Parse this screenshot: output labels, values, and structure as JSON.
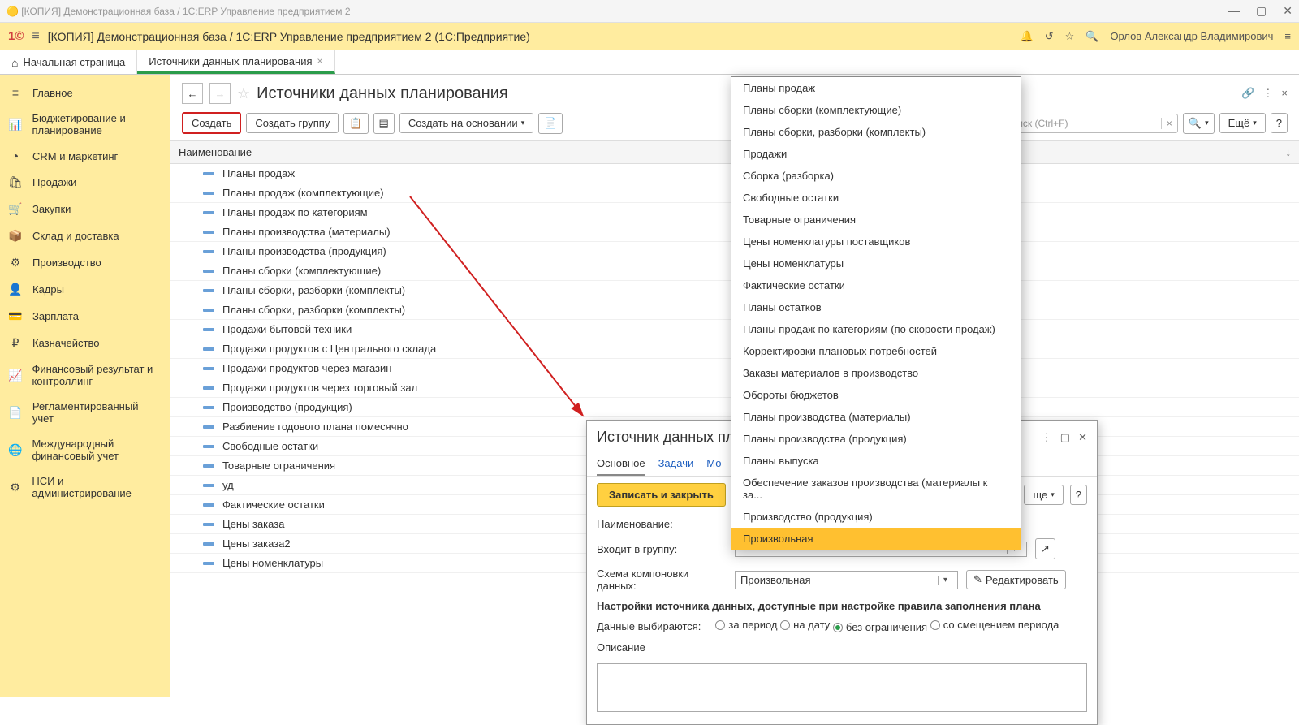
{
  "window_title": "[КОПИЯ] Демонстрационная база / 1С:ERP Управление предприятием 2",
  "app_header": "[КОПИЯ] Демонстрационная база / 1С:ERP Управление предприятием 2  (1С:Предприятие)",
  "user_name": "Орлов Александр Владимирович",
  "tabs": {
    "home": "Начальная страница",
    "active": "Источники данных планирования"
  },
  "sidebar": [
    {
      "icon": "≡",
      "label": "Главное"
    },
    {
      "icon": "📊",
      "label": "Бюджетирование и планирование"
    },
    {
      "icon": "◔",
      "label": "CRM и маркетинг"
    },
    {
      "icon": "🛍",
      "label": "Продажи"
    },
    {
      "icon": "🛒",
      "label": "Закупки"
    },
    {
      "icon": "📦",
      "label": "Склад и доставка"
    },
    {
      "icon": "⚙",
      "label": "Производство"
    },
    {
      "icon": "👤",
      "label": "Кадры"
    },
    {
      "icon": "💳",
      "label": "Зарплата"
    },
    {
      "icon": "₽",
      "label": "Казначейство"
    },
    {
      "icon": "📈",
      "label": "Финансовый результат и контроллинг"
    },
    {
      "icon": "📄",
      "label": "Регламентированный учет"
    },
    {
      "icon": "🌐",
      "label": "Международный финансовый учет"
    },
    {
      "icon": "⚙",
      "label": "НСИ и администрирование"
    }
  ],
  "page_title": "Источники данных планирования",
  "toolbar": {
    "create": "Создать",
    "create_group": "Создать группу",
    "based_on": "Создать на основании",
    "search_placeholder": "Поиск (Ctrl+F)",
    "more": "Ещё",
    "help": "?"
  },
  "grid_header": "Наименование",
  "grid_rows": [
    "Планы продаж",
    "Планы продаж (комплектующие)",
    "Планы продаж по категориям",
    "Планы производства (материалы)",
    "Планы производства (продукция)",
    "Планы сборки (комплектующие)",
    "Планы сборки, разборки (комплекты)",
    "Планы сборки, разборки (комплекты)",
    "Продажи бытовой техники",
    "Продажи продуктов с Центрального склада",
    "Продажи продуктов через магазин",
    "Продажи продуктов через торговый зал",
    "Производство (продукция)",
    "Разбиение годового плана помесячно",
    "Свободные остатки",
    "Товарные ограничения",
    "уд",
    "Фактические остатки",
    "Цены заказа",
    "Цены заказа2",
    "Цены номенклатуры"
  ],
  "dropdown_items": [
    "Планы продаж",
    "Планы сборки (комплектующие)",
    "Планы сборки, разборки (комплекты)",
    "Продажи",
    "Сборка (разборка)",
    "Свободные остатки",
    "Товарные ограничения",
    "Цены номенклатуры поставщиков",
    "Цены номенклатуры",
    "Фактические остатки",
    "Планы остатков",
    "Планы продаж по категориям (по скорости продаж)",
    "Корректировки плановых потребностей",
    "Заказы материалов в производство",
    "Обороты бюджетов",
    "Планы производства (материалы)",
    "Планы производства (продукция)",
    "Планы выпуска",
    "Обеспечение заказов производства (материалы к за...",
    "Производство (продукция)",
    "Произвольная"
  ],
  "dropdown_highlight": "Произвольная",
  "dialog": {
    "title": "Источник данных пл",
    "tabs": [
      "Основное",
      "Задачи",
      "Мо"
    ],
    "save_close": "Записать и закрыть",
    "more": "ще",
    "help": "?",
    "name_label": "Наименование:",
    "group_label": "Входит в группу:",
    "scheme_label": "Схема компоновки данных:",
    "scheme_value": "Произвольная",
    "edit_btn": "Редактировать",
    "settings_title": "Настройки источника данных, доступные при настройке правила заполнения плана",
    "select_label": "Данные выбираются:",
    "radios": [
      "за период",
      "на дату",
      "без ограничения",
      "со смещением периода"
    ],
    "selected_radio": "без ограничения",
    "desc_label": "Описание"
  }
}
